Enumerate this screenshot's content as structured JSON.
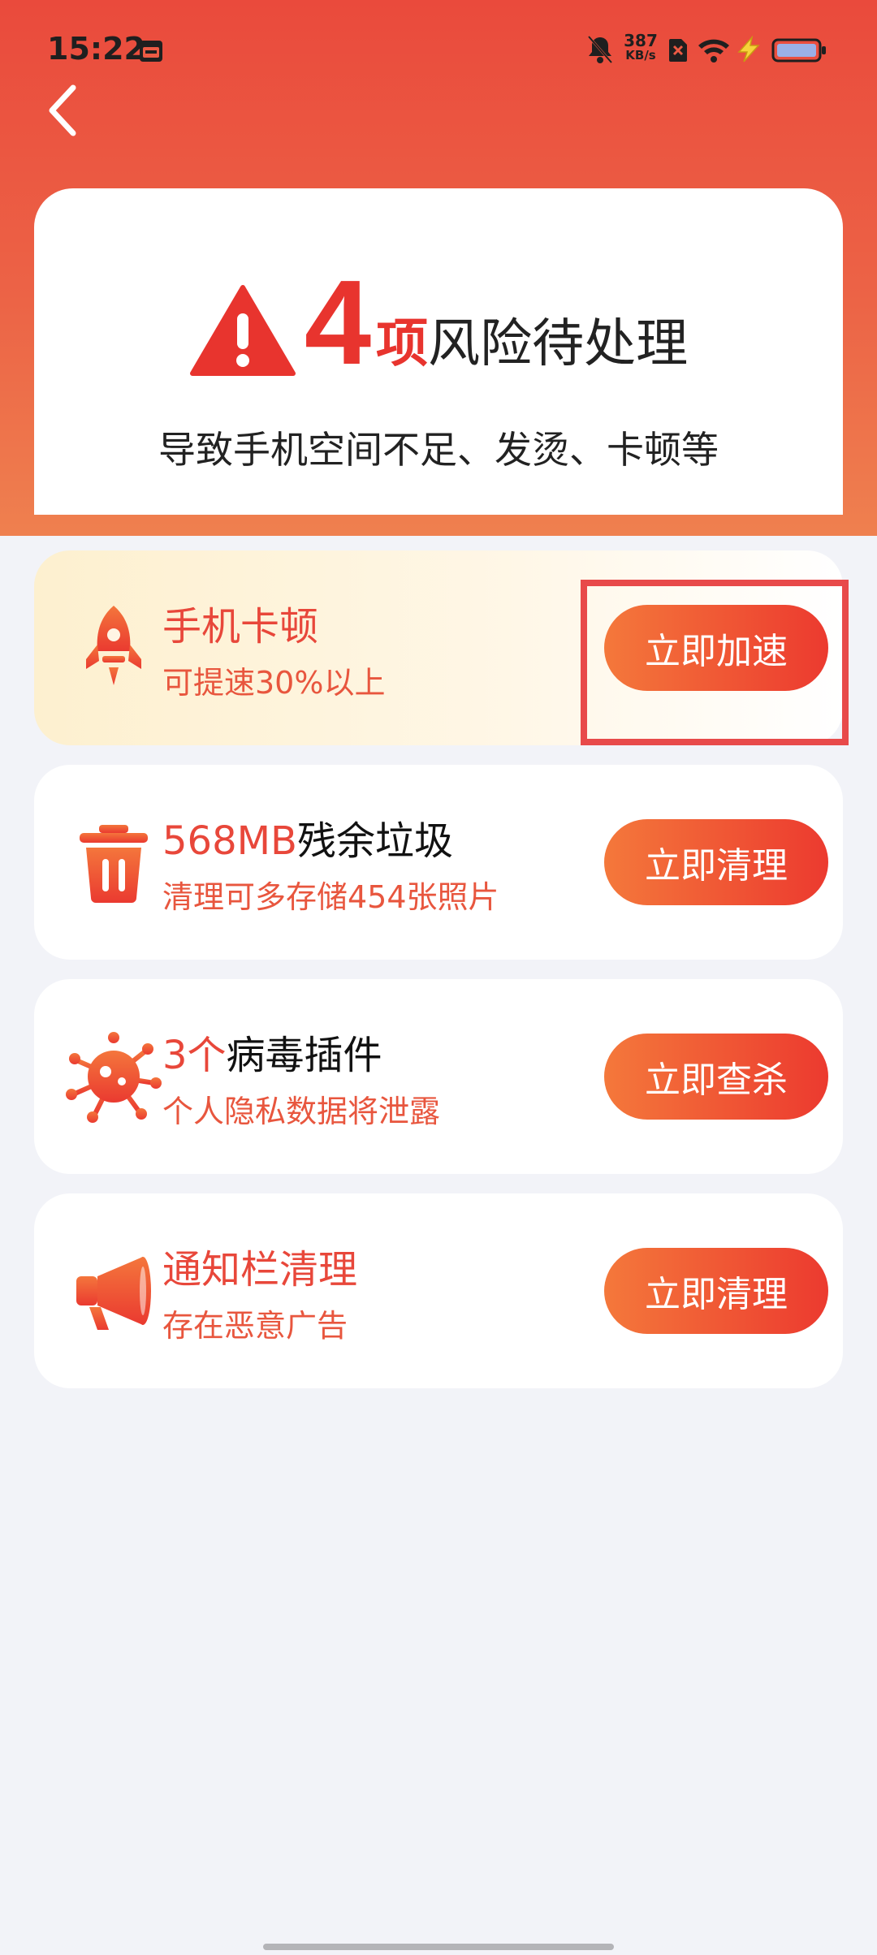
{
  "status_bar": {
    "time": "15:22",
    "net_speed_value": "387",
    "net_speed_unit": "KB/s"
  },
  "summary": {
    "risk_count": "4",
    "risk_unit": "项",
    "risk_text": "风险待处理",
    "subtitle": "导致手机空间不足、发烫、卡顿等"
  },
  "items": [
    {
      "title_highlight": "",
      "title_rest": "手机卡顿",
      "subtitle": "可提速30%以上",
      "button": "立即加速",
      "icon": "rocket-icon"
    },
    {
      "title_highlight": "568MB",
      "title_rest": "残余垃圾",
      "subtitle": "清理可多存储454张照片",
      "button": "立即清理",
      "icon": "trash-icon"
    },
    {
      "title_highlight": "3个",
      "title_rest": "病毒插件",
      "subtitle": "个人隐私数据将泄露",
      "button": "立即查杀",
      "icon": "virus-icon"
    },
    {
      "title_highlight": "",
      "title_rest": "通知栏清理",
      "subtitle": "存在恶意广告",
      "button": "立即清理",
      "icon": "megaphone-icon"
    }
  ],
  "colors": {
    "accent": "#e8342e",
    "header_top": "#ea4a3c",
    "header_bottom": "#ef804f",
    "highlight_frame": "#e84a4a"
  }
}
